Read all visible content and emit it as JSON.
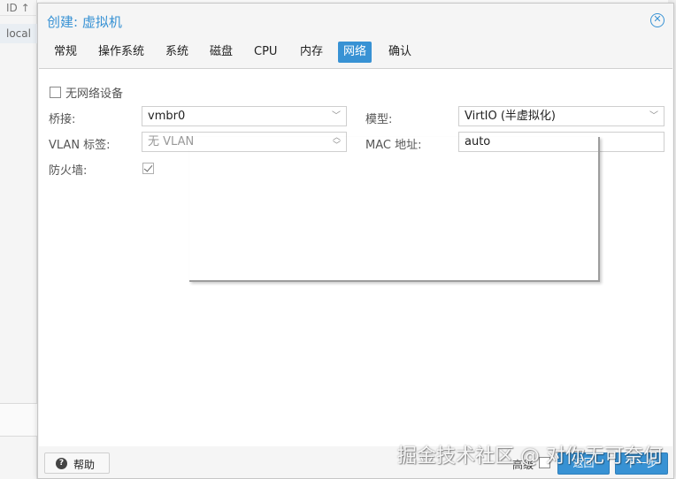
{
  "background": {
    "col_header": "ID ↑",
    "row_label": "local"
  },
  "dialog": {
    "title": "创建: 虚拟机",
    "close_icon": "close-circle-icon",
    "tabs": [
      {
        "label": "常规",
        "active": false
      },
      {
        "label": "操作系统",
        "active": false
      },
      {
        "label": "系统",
        "active": false
      },
      {
        "label": "磁盘",
        "active": false
      },
      {
        "label": "CPU",
        "active": false
      },
      {
        "label": "内存",
        "active": false
      },
      {
        "label": "网络",
        "active": true
      },
      {
        "label": "确认",
        "active": false
      }
    ],
    "network": {
      "no_device_label": "无网络设备",
      "no_device_checked": false,
      "bridge_label": "桥接:",
      "bridge_value": "vmbr0",
      "vlan_label": "VLAN 标签:",
      "vlan_value": "无 VLAN",
      "firewall_label": "防火墙:",
      "firewall_checked": true,
      "model_label": "模型:",
      "model_value": "VirtIO (半虚拟化)",
      "mac_label": "MAC 地址:",
      "mac_value": "auto"
    },
    "footer": {
      "help_label": "帮助",
      "help_icon": "question-circle-icon",
      "advanced_label": "高级",
      "advanced_checked": false,
      "back_label": "返回",
      "next_label": "下一步"
    }
  },
  "watermark": "掘金技术社区 @ 对你无可奈何",
  "colors": {
    "accent": "#3892d4",
    "panel_bg": "#ffffff",
    "dialog_bg": "#f5f5f5"
  }
}
